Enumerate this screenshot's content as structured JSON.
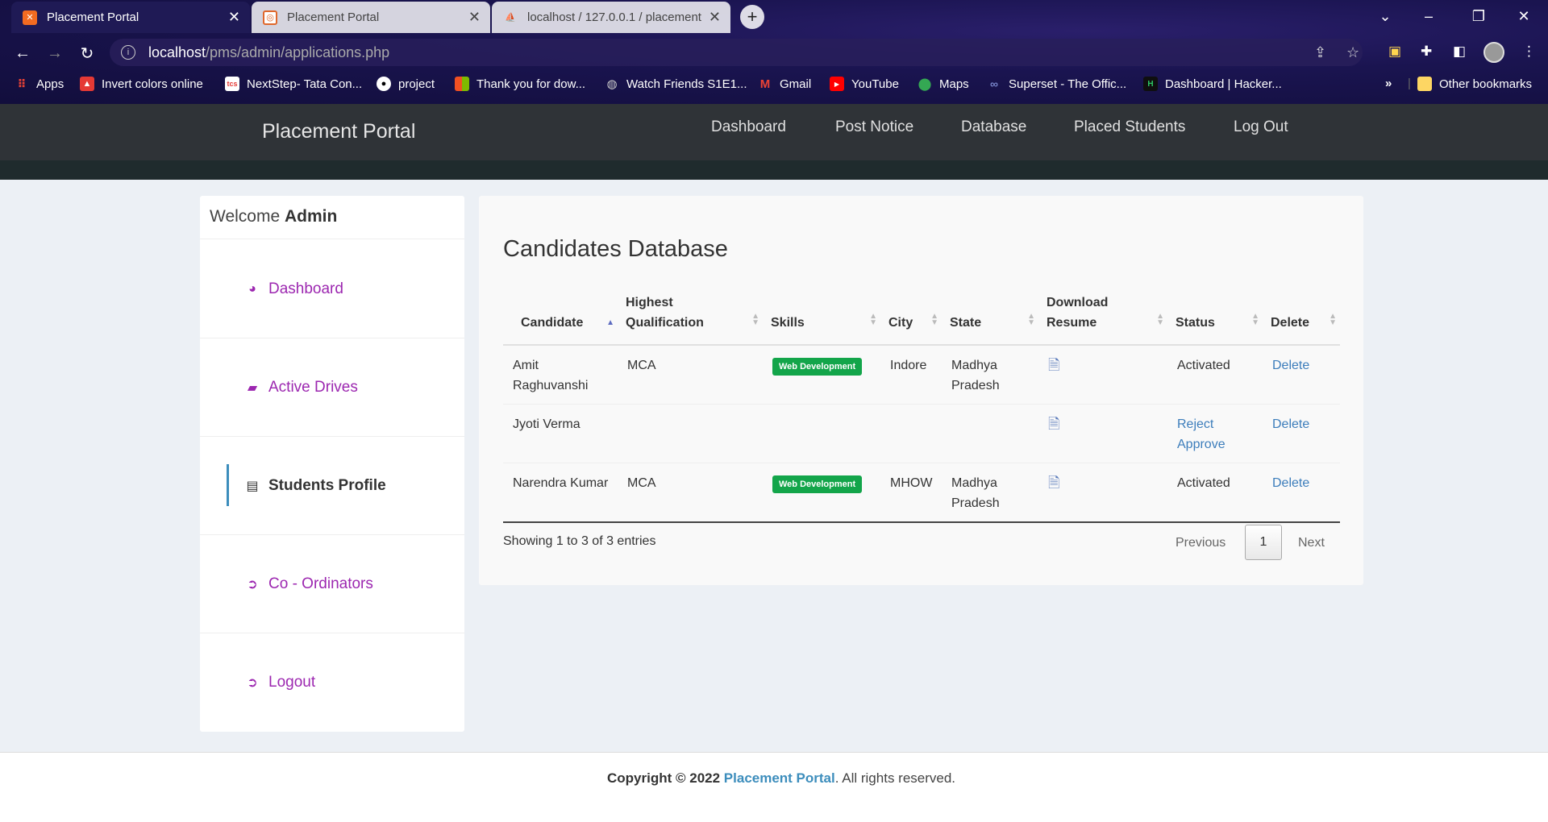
{
  "browser": {
    "tabs": [
      {
        "title": "Placement Portal",
        "active": true
      },
      {
        "title": "Placement Portal",
        "active": false
      },
      {
        "title": "localhost / 127.0.0.1 / placement",
        "active": false
      }
    ],
    "url_host": "localhost",
    "url_path": "/pms/admin/applications.php",
    "bookmarks": [
      {
        "label": "Apps",
        "icon": "apps-grid-icon"
      },
      {
        "label": "Invert colors online",
        "icon": "invert-icon"
      },
      {
        "label": "NextStep- Tata Con...",
        "icon": "tcs-icon"
      },
      {
        "label": "project",
        "icon": "github-icon"
      },
      {
        "label": "Thank you for dow...",
        "icon": "windows-icon"
      },
      {
        "label": "Watch Friends S1E1...",
        "icon": "globe-icon"
      },
      {
        "label": "Gmail",
        "icon": "gmail-icon"
      },
      {
        "label": "YouTube",
        "icon": "youtube-icon"
      },
      {
        "label": "Maps",
        "icon": "maps-icon"
      },
      {
        "label": "Superset - The Offic...",
        "icon": "superset-icon"
      },
      {
        "label": "Dashboard | Hacker...",
        "icon": "hackerrank-icon"
      }
    ],
    "more_bookmarks": "»",
    "other_bookmarks": "Other bookmarks"
  },
  "site": {
    "brand": "Placement Portal",
    "nav": [
      "Dashboard",
      "Post Notice",
      "Database",
      "Placed Students",
      "Log Out"
    ]
  },
  "sidebar": {
    "welcome_prefix": "Welcome",
    "welcome_name": "Admin",
    "items": [
      {
        "label": "Dashboard",
        "icon": "dashboard-gauge-icon"
      },
      {
        "label": "Active Drives",
        "icon": "briefcase-icon"
      },
      {
        "label": "Students Profile",
        "icon": "id-card-icon",
        "active": true
      },
      {
        "label": "Co - Ordinators",
        "icon": "circle-arrow-icon"
      },
      {
        "label": "Logout",
        "icon": "circle-arrow-icon"
      }
    ]
  },
  "main": {
    "title": "Candidates Database",
    "columns": [
      "Candidate",
      "Highest Qualification",
      "Skills",
      "City",
      "State",
      "Download Resume",
      "Status",
      "Delete"
    ],
    "rows": [
      {
        "candidate": "Amit Raghuvanshi",
        "qualification": "MCA",
        "skills": "Web Development",
        "city": "Indore",
        "state": "Madhya Pradesh",
        "status": "Activated",
        "delete": "Delete"
      },
      {
        "candidate": "Jyoti Verma",
        "qualification": "",
        "skills": "",
        "city": "",
        "state": "",
        "status_reject": "Reject",
        "status_approve": "Approve",
        "delete": "Delete"
      },
      {
        "candidate": "Narendra Kumar",
        "qualification": "MCA",
        "skills": "Web Development",
        "city": "MHOW",
        "state": "Madhya Pradesh",
        "status": "Activated",
        "delete": "Delete"
      }
    ],
    "showing": "Showing 1 to 3 of 3 entries",
    "pager": {
      "previous": "Previous",
      "page": "1",
      "next": "Next"
    }
  },
  "footer": {
    "copyright": "Copyright © 2022",
    "brand": "Placement Portal",
    "suffix": ". All rights reserved."
  },
  "colors": {
    "sidebar_link": "#9c27b0",
    "badge": "#13a54a",
    "link": "#3c7dbb",
    "header": "#2f3337"
  }
}
